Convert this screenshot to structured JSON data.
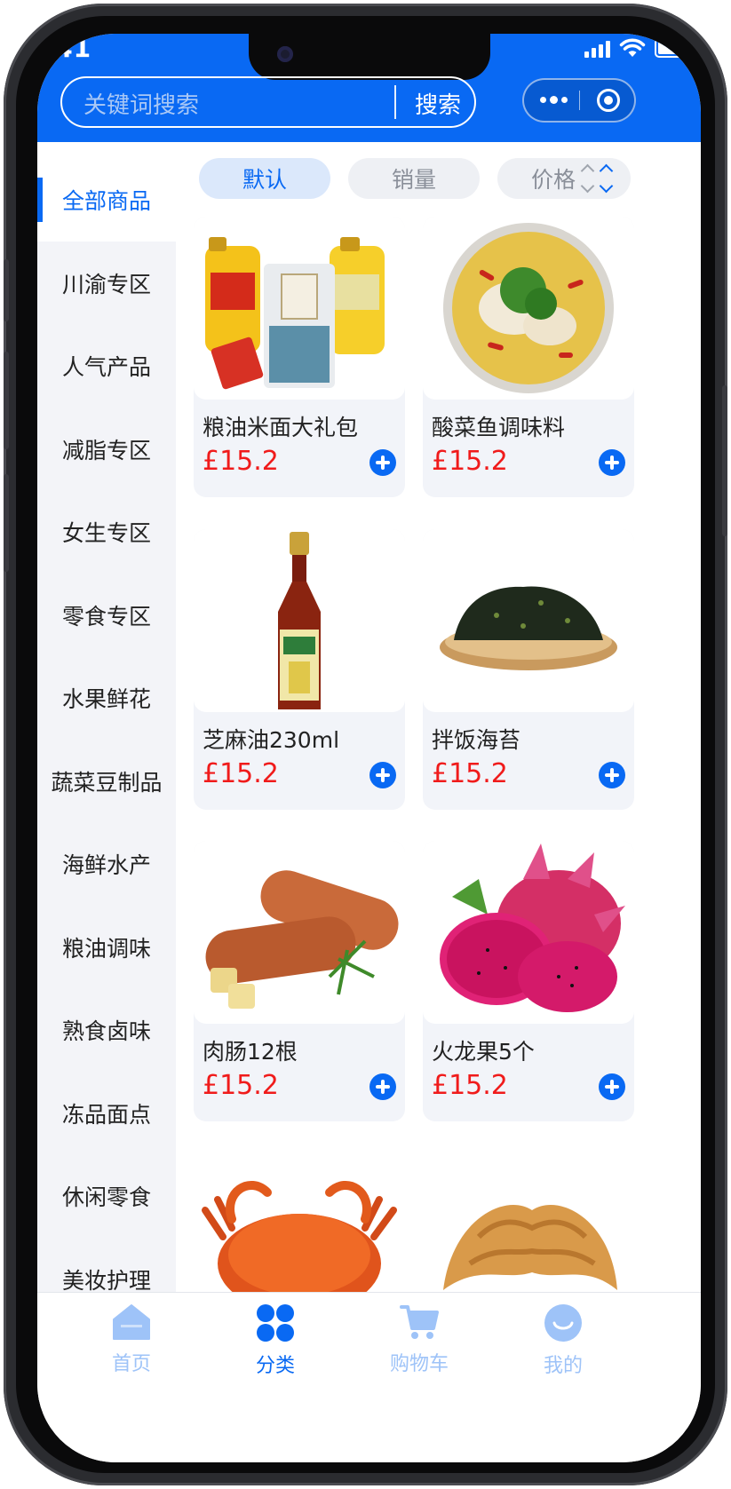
{
  "status_bar": {
    "time": ":41"
  },
  "header": {
    "search_placeholder": "关键词搜索",
    "search_button": "搜索"
  },
  "sidebar": {
    "items": [
      {
        "label": "全部商品",
        "active": true
      },
      {
        "label": "川渝专区"
      },
      {
        "label": "人气产品"
      },
      {
        "label": "减脂专区"
      },
      {
        "label": "女生专区"
      },
      {
        "label": "零食专区"
      },
      {
        "label": "水果鲜花"
      },
      {
        "label": "蔬菜豆制品"
      },
      {
        "label": "海鲜水产"
      },
      {
        "label": "粮油调味"
      },
      {
        "label": "熟食卤味"
      },
      {
        "label": "冻品面点"
      },
      {
        "label": "休闲零食"
      },
      {
        "label": "美妆护理"
      }
    ]
  },
  "sort_tabs": [
    {
      "label": "默认",
      "active": true
    },
    {
      "label": "销量"
    },
    {
      "label": "价格"
    }
  ],
  "products": [
    {
      "name": "粮油米面大礼包",
      "price": "£15.2",
      "image": "grain-oil-gift-pack"
    },
    {
      "name": "酸菜鱼调味料",
      "price": "£15.2",
      "image": "pickled-fish-seasoning"
    },
    {
      "name": "芝麻油230ml",
      "price": "£15.2",
      "image": "sesame-oil-bottle"
    },
    {
      "name": "拌饭海苔",
      "price": "£15.2",
      "image": "seaweed-plate"
    },
    {
      "name": "肉肠12根",
      "price": "£15.2",
      "image": "sausages"
    },
    {
      "name": "火龙果5个",
      "price": "£15.2",
      "image": "dragon-fruit"
    },
    {
      "name": "",
      "price": "",
      "image": "crab"
    },
    {
      "name": "",
      "price": "",
      "image": "croissant"
    }
  ],
  "tabbar": {
    "items": [
      {
        "label": "首页",
        "icon": "home-icon"
      },
      {
        "label": "分类",
        "icon": "category-icon",
        "active": true
      },
      {
        "label": "购物车",
        "icon": "cart-icon"
      },
      {
        "label": "我的",
        "icon": "profile-icon"
      }
    ]
  },
  "colors": {
    "primary": "#0969f3",
    "price": "#f01b1b",
    "sidebar_bg": "#f3f4f8",
    "card_bg": "#f2f4f9"
  }
}
